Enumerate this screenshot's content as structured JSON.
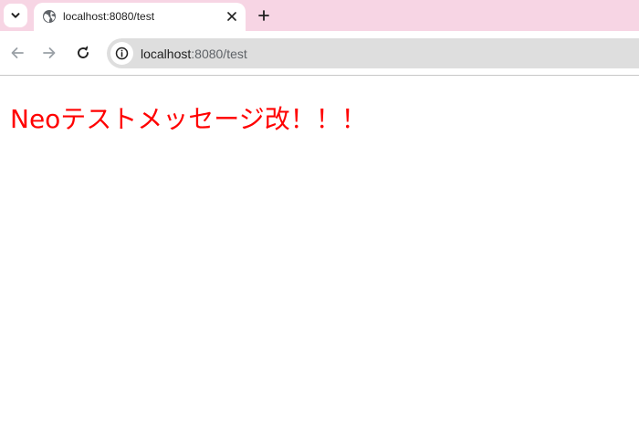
{
  "browser": {
    "tab": {
      "title": "localhost:8080/test",
      "favicon": "globe-icon"
    },
    "tab_search_icon": "chevron-down-icon",
    "close_icon": "close-icon",
    "new_tab_icon": "plus-icon",
    "nav": {
      "back_icon": "arrow-left-icon",
      "forward_icon": "arrow-right-icon",
      "reload_icon": "reload-icon"
    },
    "omnibox": {
      "site_info_icon": "info-icon",
      "url_host": "localhost",
      "url_rest": ":8080/test"
    },
    "colors": {
      "tabstrip": "#f7d5e4",
      "omnibox": "#dedede"
    }
  },
  "page": {
    "message": "Neoテストメッセージ改！！！",
    "message_color": "#ff0000"
  }
}
